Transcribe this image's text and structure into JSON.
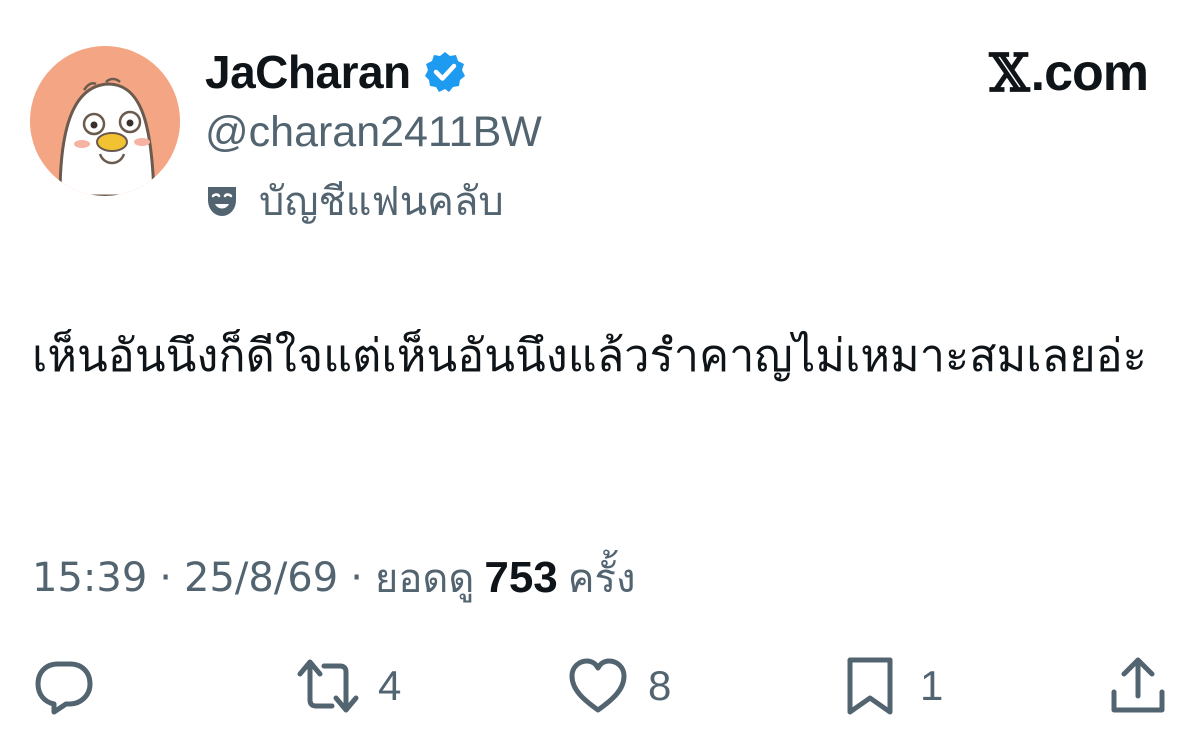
{
  "author": {
    "display_name": "JaCharan",
    "handle": "@charan2411BW",
    "account_label": "บัญชีแฟนคลับ",
    "verified": true,
    "verified_color": "#1d9bf0",
    "avatar_bg": "#f4a684"
  },
  "site": {
    "logo_text": ".com",
    "logo_mark": "𝕏"
  },
  "tweet": {
    "text": "เห็นอันนึงก็ดีใจแต่เห็นอันนึงแล้วรำคาญไม่เหมาะสมเลยอ่ะ"
  },
  "meta": {
    "time": "15:39",
    "separator": "·",
    "date": "25/8/69",
    "views_label": "ยอดดู",
    "views_count": "753",
    "views_unit": "ครั้ง"
  },
  "actions": {
    "reply_icon": "reply-icon",
    "retweet_count": "4",
    "like_count": "8",
    "bookmark_count": "1",
    "share_icon": "share-icon"
  },
  "colors": {
    "text_primary": "#0f1419",
    "text_secondary": "#536471"
  }
}
